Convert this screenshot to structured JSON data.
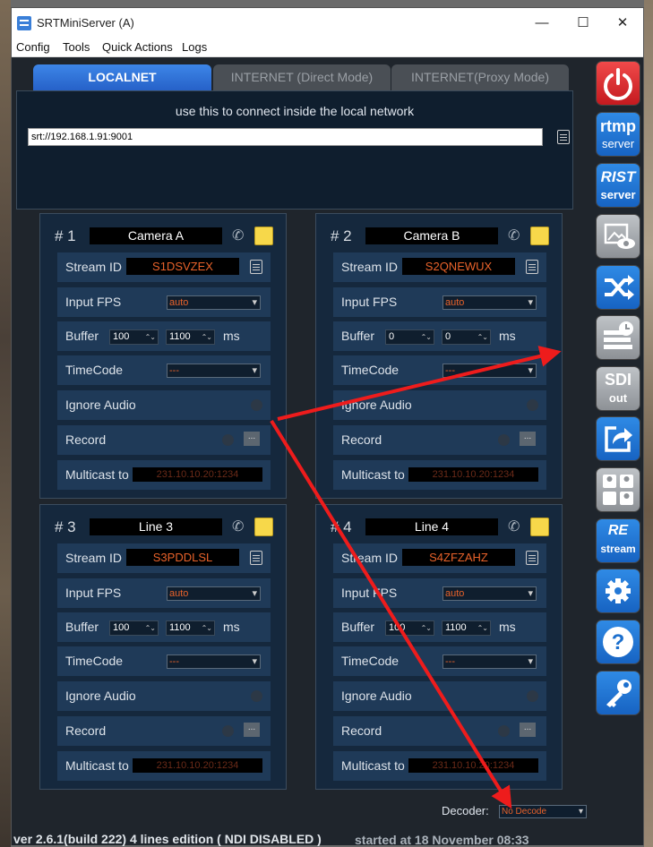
{
  "window": {
    "title": "SRTMiniServer (A)",
    "minimize": "—",
    "maximize": "☐",
    "close": "✕"
  },
  "menu": [
    "Config",
    "Tools",
    "Quick Actions",
    "Logs"
  ],
  "tabs": [
    "LOCALNET",
    "INTERNET (Direct Mode)",
    "INTERNET(Proxy Mode)"
  ],
  "localnet": {
    "caption": "use this to connect inside the local network",
    "url": "srt://192.168.1.91:9001"
  },
  "labels": {
    "stream_id": "Stream ID",
    "input_fps": "Input FPS",
    "buffer": "Buffer",
    "ms": "ms",
    "timecode": "TimeCode",
    "ignore_audio": "Ignore Audio",
    "record": "Record",
    "multicast": "Multicast to",
    "dots": "..."
  },
  "cards": [
    {
      "num": "# 1",
      "name": "Camera A",
      "stream_id": "S1DSVZEX",
      "fps": "auto",
      "buf_min": "100",
      "buf_max": "1100",
      "timecode": "---",
      "multicast": "231.10.10.20:1234"
    },
    {
      "num": "# 2",
      "name": "Camera B",
      "stream_id": "S2QNEWUX",
      "fps": "auto",
      "buf_min": "0",
      "buf_max": "0",
      "timecode": "---",
      "multicast": "231.10.10.20:1234"
    },
    {
      "num": "# 3",
      "name": "Line 3",
      "stream_id": "S3PDDLSL",
      "fps": "auto",
      "buf_min": "100",
      "buf_max": "1100",
      "timecode": "---",
      "multicast": "231.10.10.20:1234"
    },
    {
      "num": "# 4",
      "name": "Line 4",
      "stream_id": "S4ZFZAHZ",
      "fps": "auto",
      "buf_min": "100",
      "buf_max": "1100",
      "timecode": "---",
      "multicast": "231.10.10.20:1234"
    }
  ],
  "sidebar": {
    "rtmp": [
      "rtmp",
      "server"
    ],
    "rist": [
      "RIST",
      "server"
    ],
    "sdi": [
      "SDI",
      "out"
    ],
    "restream": [
      "RE",
      "stream"
    ]
  },
  "decoder": {
    "label": "Decoder:",
    "value": "No Decode"
  },
  "status": {
    "version": "ver 2.6.1(build 222) 4 lines edition ( NDI DISABLED )",
    "started": "started at 18 November 08:33"
  },
  "colors": {
    "accent": "#2f8ae5",
    "power": "#e0242a",
    "stream_id": "#e8622a",
    "arrow": "#ee1c1c"
  }
}
